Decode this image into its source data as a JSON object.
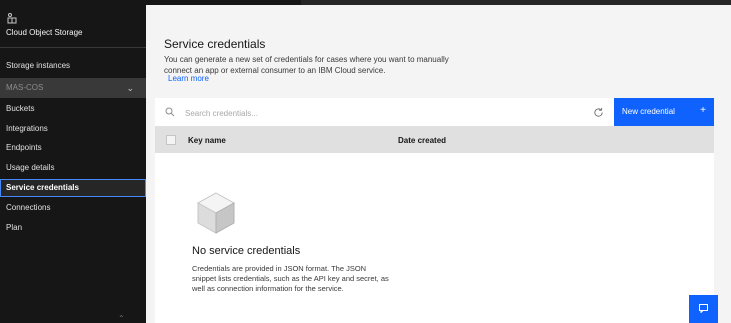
{
  "sidebar": {
    "title": "Cloud Object Storage",
    "storage_instances": "Storage instances",
    "section": "MAS-COS",
    "items": [
      {
        "label": "Buckets"
      },
      {
        "label": "Integrations"
      },
      {
        "label": "Endpoints"
      },
      {
        "label": "Usage details"
      },
      {
        "label": "Service credentials",
        "active": true
      },
      {
        "label": "Connections"
      },
      {
        "label": "Plan"
      }
    ]
  },
  "main": {
    "title": "Service credentials",
    "description": "You can generate a new set of credentials for cases where you want to manually connect an app or external consumer to an IBM Cloud service.",
    "learn_more": "Learn more",
    "search": {
      "placeholder": "Search credentials..."
    },
    "new_button": "New credential",
    "new_button_icon": "+",
    "table": {
      "columns": [
        "Key name",
        "Date created"
      ]
    },
    "empty_state": {
      "title": "No service credentials",
      "description": "Credentials are provided in JSON format. The JSON snippet lists credentials, such as the API key and secret, as well as connection information for the service."
    }
  },
  "colors": {
    "accent": "#0f62fe",
    "sidebar_bg": "#161616",
    "active_outline": "#4589ff"
  },
  "icons": [
    "object-storage-icon",
    "chevron-down-icon",
    "search-icon",
    "refresh-icon",
    "add-icon",
    "cube-icon",
    "help-icon"
  ]
}
